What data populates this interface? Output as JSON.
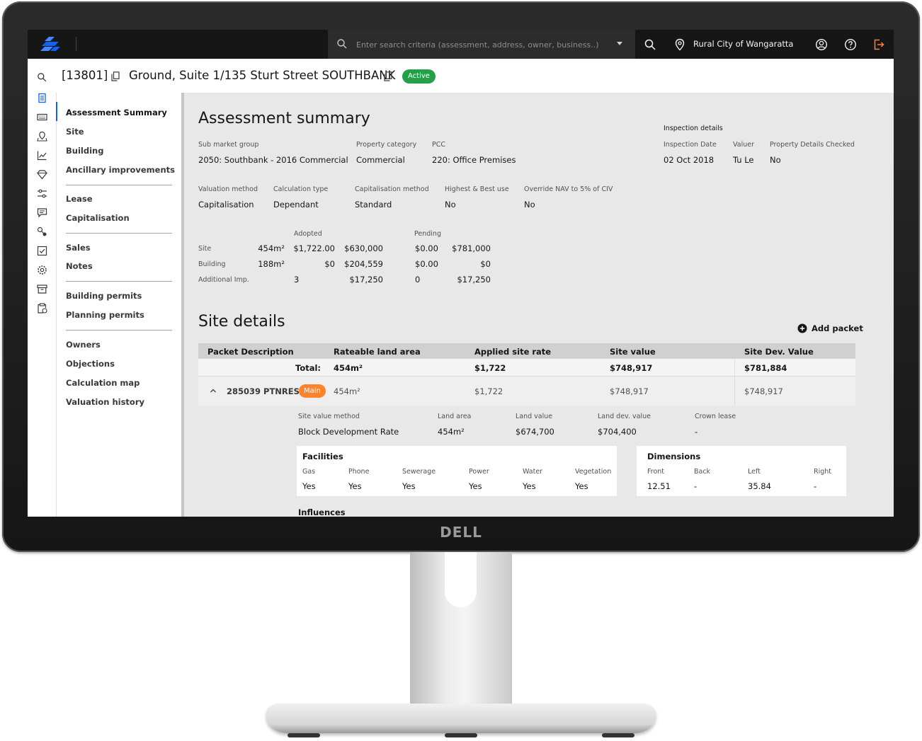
{
  "device": {
    "brand": "DELL"
  },
  "topbar": {
    "search_placeholder": "Enter search criteria (assessment, address, owner, business..)",
    "location": "Rural City of Wangaratta"
  },
  "header": {
    "assessment_id": "[13801]",
    "address": "Ground, Suite 1/135 Sturt Street SOUTHBANK",
    "status": "Active"
  },
  "nav": {
    "items": [
      "Assessment Summary",
      "Site",
      "Building",
      "Ancillary improvements",
      "Lease",
      "Capitalisation",
      "Sales",
      "Notes",
      "Building permits",
      "Planning permits",
      "Owners",
      "Objections",
      "Calculation map",
      "Valuation history"
    ]
  },
  "summary": {
    "title": "Assessment summary",
    "fields1": [
      {
        "label": "Sub market group",
        "value": "2050: Southbank - 2016 Commercial"
      },
      {
        "label": "Property category",
        "value": "Commercial"
      },
      {
        "label": "PCC",
        "value": "220: Office Premises"
      }
    ],
    "inspection": {
      "title": "Inspection details",
      "fields": [
        {
          "label": "Inspection Date",
          "value": "02 Oct 2018"
        },
        {
          "label": "Valuer",
          "value": "Tu Le"
        },
        {
          "label": "Property Details Checked",
          "value": "No"
        }
      ]
    },
    "fields2": [
      {
        "label": "Valuation method",
        "value": "Capitalisation"
      },
      {
        "label": "Calculation type",
        "value": "Dependant"
      },
      {
        "label": "Capitalisation method",
        "value": "Standard"
      },
      {
        "label": "Highest & Best use",
        "value": "No"
      },
      {
        "label": "Override NAV to 5% of CIV",
        "value": "No"
      }
    ],
    "values_table": {
      "adopted_label": "Adopted",
      "pending_label": "Pending",
      "rows": [
        {
          "label": "Site",
          "area": "454m²",
          "rate": "$1,722.00",
          "adopted": "$630,000",
          "pending_rate": "$0.00",
          "pending": "$781,000"
        },
        {
          "label": "Building",
          "area": "188m²",
          "rate": "$0",
          "adopted": "$204,559",
          "pending_rate": "$0.00",
          "pending": "$0"
        },
        {
          "label": "Additional Imp.",
          "area": "",
          "rate": "3",
          "adopted": "$17,250",
          "pending_rate": "0",
          "pending": "$17,250"
        }
      ]
    }
  },
  "site": {
    "title": "Site details",
    "add_packet": "Add packet",
    "columns": [
      "Packet Description",
      "Rateable land area",
      "Applied site rate",
      "Site value",
      "Site Dev. Value"
    ],
    "total": {
      "label": "Total:",
      "area": "454m²",
      "rate": "$1,722",
      "site_value": "$748,917",
      "dev_value": "$781,884"
    },
    "packet": {
      "name": "285039 PTNRES",
      "tag": "Main",
      "area": "454m²",
      "rate": "$1,722",
      "site_value": "$748,917",
      "dev_value": "$748,917",
      "details": [
        {
          "label": "Site value method",
          "value": "Block Development Rate"
        },
        {
          "label": "Land area",
          "value": "454m²"
        },
        {
          "label": "Land value",
          "value": "$674,700"
        },
        {
          "label": "Land dev. value",
          "value": "$704,400"
        },
        {
          "label": "Crown lease",
          "value": "-"
        }
      ],
      "facilities": {
        "title": "Facilities",
        "items": [
          {
            "label": "Gas",
            "value": "Yes"
          },
          {
            "label": "Phone",
            "value": "Yes"
          },
          {
            "label": "Sewerage",
            "value": "Yes"
          },
          {
            "label": "Power",
            "value": "Yes"
          },
          {
            "label": "Water",
            "value": "Yes"
          },
          {
            "label": "Vegetation",
            "value": "Yes"
          }
        ]
      },
      "dimensions": {
        "title": "Dimensions",
        "items": [
          {
            "label": "Front",
            "value": "12.51"
          },
          {
            "label": "Back",
            "value": "-"
          },
          {
            "label": "Left",
            "value": "35.84"
          },
          {
            "label": "Right",
            "value": "-"
          }
        ]
      },
      "influences_title": "Influences"
    }
  }
}
